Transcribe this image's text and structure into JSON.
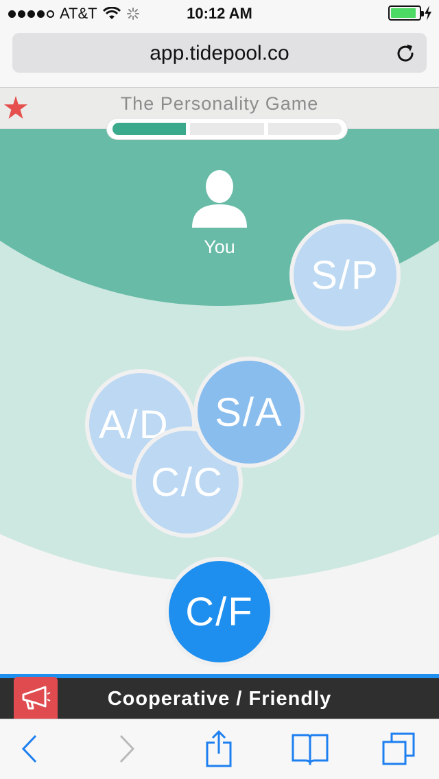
{
  "status_bar": {
    "carrier": "AT&T",
    "time": "10:12 AM",
    "signal_bars": 4,
    "signal_total": 5,
    "battery_level": 0.9,
    "battery_color": "#4cd964"
  },
  "browser": {
    "url": "app.tidepool.co",
    "icons": [
      "reload-icon",
      "back-icon",
      "forward-icon",
      "share-icon",
      "bookmarks-icon",
      "tabs-icon"
    ]
  },
  "game": {
    "title": "The Personality Game",
    "progress_steps_total": 3,
    "progress_steps_done": 1,
    "accent_color": "#3aa98c",
    "you_label": "You",
    "bubbles": {
      "sp": "S/P",
      "ad": "A/D",
      "cc": "C/C",
      "sa": "S/A",
      "cf": "C/F"
    },
    "selected_trait": "Cooperative / Friendly",
    "selected_color": "#1e8fee"
  }
}
